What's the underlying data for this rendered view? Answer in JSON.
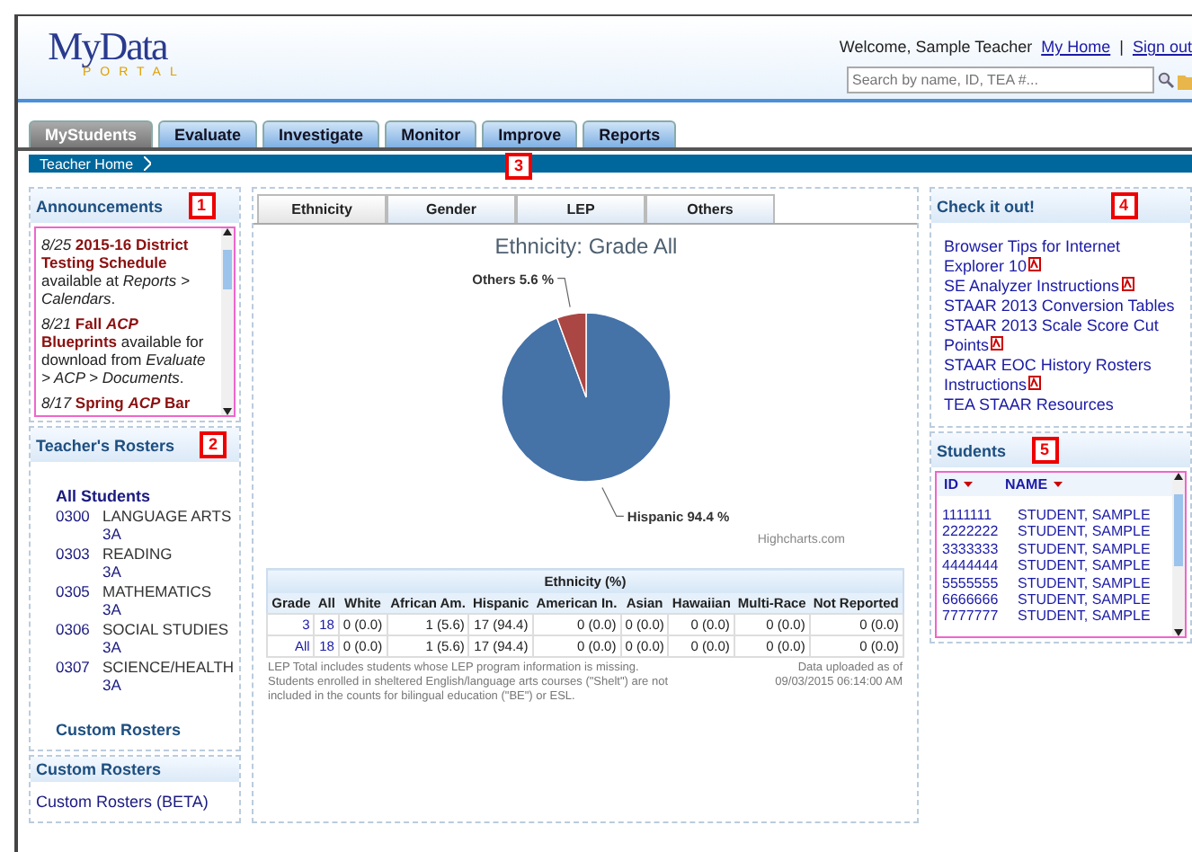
{
  "header": {
    "logo_main": "MyData",
    "logo_sub": "PORTAL",
    "welcome": "Welcome,  Sample Teacher",
    "links": [
      "My Home",
      "Sign out"
    ],
    "separator": "|",
    "search": {
      "placeholder": "Search by name, ID, TEA #..."
    }
  },
  "nav_tabs": [
    {
      "label": "MyStudents",
      "selected": true
    },
    {
      "label": "Evaluate",
      "selected": false
    },
    {
      "label": "Investigate",
      "selected": false
    },
    {
      "label": "Monitor",
      "selected": false
    },
    {
      "label": "Improve",
      "selected": false
    },
    {
      "label": "Reports",
      "selected": false
    }
  ],
  "breadcrumb": {
    "label": "Teacher Home",
    "callout": "3"
  },
  "announcements": {
    "title": "Announcements",
    "callout": "1",
    "items": [
      {
        "date": "8/25",
        "title": "2015-16 District Testing Schedule",
        "body": "available at *Reports > Calendars*."
      },
      {
        "date": "8/21",
        "title": "Fall *ACP* Blueprints",
        "body": "available for download from *Evaluate > ACP > Documents*."
      },
      {
        "date": "8/17",
        "title": "Spring *ACP* Bar"
      }
    ]
  },
  "rosters": {
    "title": "Teacher's Rosters",
    "callout": "2",
    "all": "All Students",
    "items": [
      {
        "code": "0300",
        "name": "LANGUAGE ARTS",
        "section": "3A"
      },
      {
        "code": "0303",
        "name": "READING",
        "section": "3A"
      },
      {
        "code": "0305",
        "name": "MATHEMATICS",
        "section": "3A"
      },
      {
        "code": "0306",
        "name": "SOCIAL STUDIES",
        "section": "3A"
      },
      {
        "code": "0307",
        "name": "SCIENCE/HEALTH",
        "section": "3A"
      }
    ],
    "custom": "Custom Rosters"
  },
  "custom_rosters": {
    "title": "Custom Rosters",
    "link": "Custom Rosters (BETA)"
  },
  "chart_tabs": [
    {
      "label": "Ethnicity",
      "selected": true
    },
    {
      "label": "Gender",
      "selected": false
    },
    {
      "label": "LEP",
      "selected": false
    },
    {
      "label": "Others",
      "selected": false
    }
  ],
  "chart_data": {
    "type": "pie",
    "title": "Ethnicity: Grade All",
    "colors": [
      "#4572a7",
      "#aa4643"
    ],
    "values": [
      94.4,
      5.6
    ],
    "value_labels": [
      "Hispanic 94.4 %",
      "Others 5.6 %"
    ]
  },
  "credit": "Highcharts.com",
  "table": {
    "title": "Ethnicity (%)",
    "columns": [
      "Grade",
      "All",
      "White",
      "African Am.",
      "Hispanic",
      "American In.",
      "Asian",
      "Hawaiian",
      "Multi-Race",
      "Not Reported"
    ],
    "rows": [
      [
        "3",
        "18",
        "0 (0.0)",
        "1 (5.6)",
        "17 (94.4)",
        "0 (0.0)",
        "0 (0.0)",
        "0 (0.0)",
        "0 (0.0)",
        "0 (0.0)"
      ],
      [
        "All",
        "18",
        "0 (0.0)",
        "1 (5.6)",
        "17 (94.4)",
        "0 (0.0)",
        "0 (0.0)",
        "0 (0.0)",
        "0 (0.0)",
        "0 (0.0)"
      ]
    ]
  },
  "notes": [
    "LEP Total includes students whose LEP program information is missing.",
    "Students enrolled in sheltered English/language arts courses (\"Shelt\") are not included in the counts for bilingual education (\"BE\") or ESL."
  ],
  "upload_note": "Data uploaded as of 09/03/2015 06:14:00 AM",
  "check_it_out": {
    "title": "Check it out!",
    "callout": "4",
    "links": [
      {
        "label": "Browser Tips for Internet Explorer 10",
        "pdf": true
      },
      {
        "label": "SE Analyzer Instructions",
        "pdf": true
      },
      {
        "label": "STAAR 2013 Conversion Tables",
        "pdf": false
      },
      {
        "label": "STAAR 2013 Scale Score Cut Points",
        "pdf": true
      },
      {
        "label": "STAAR EOC History Rosters Instructions",
        "pdf": true
      },
      {
        "label": "TEA STAAR Resources",
        "pdf": false
      }
    ]
  },
  "students": {
    "title": "Students",
    "callout": "5",
    "columns": [
      "ID",
      "NAME"
    ],
    "rows": [
      [
        "1111111",
        "STUDENT, SAMPLE"
      ],
      [
        "2222222",
        "STUDENT, SAMPLE"
      ],
      [
        "3333333",
        "STUDENT, SAMPLE"
      ],
      [
        "4444444",
        "STUDENT, SAMPLE"
      ],
      [
        "5555555",
        "STUDENT, SAMPLE"
      ],
      [
        "6666666",
        "STUDENT, SAMPLE"
      ],
      [
        "7777777",
        "STUDENT, SAMPLE"
      ]
    ]
  }
}
